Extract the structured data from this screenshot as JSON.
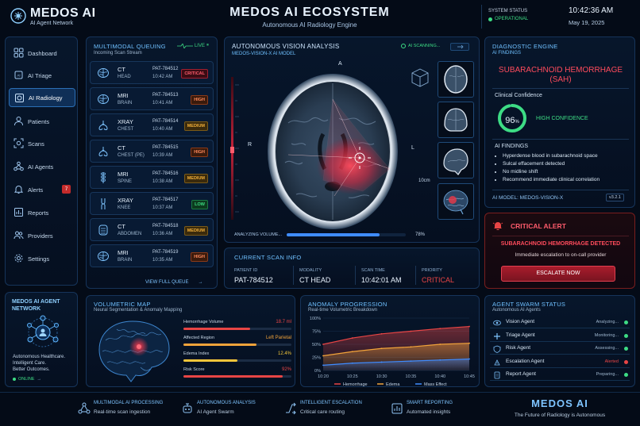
{
  "header": {
    "brand": "MEDOS AI",
    "brand_sub": "AI Agent Network",
    "title": "MEDOS AI ECOSYSTEM",
    "subtitle": "Autonomous AI Radiology Engine",
    "system_status_label": "SYSTEM STATUS",
    "system_status_value": "OPERATIONAL",
    "time": "10:42:36 AM",
    "date": "May 19, 2025"
  },
  "sidebar": {
    "items": [
      {
        "label": "Dashboard",
        "icon": "grid-icon"
      },
      {
        "label": "AI Triage",
        "icon": "ai-chip-icon"
      },
      {
        "label": "AI Radiology",
        "icon": "radiology-icon",
        "active": true
      },
      {
        "label": "Patients",
        "icon": "user-icon"
      },
      {
        "label": "Scans",
        "icon": "scan-icon"
      },
      {
        "label": "AI Agents",
        "icon": "agents-icon"
      },
      {
        "label": "Alerts",
        "icon": "bell-icon",
        "badge": "7"
      },
      {
        "label": "Reports",
        "icon": "chart-icon"
      },
      {
        "label": "Providers",
        "icon": "people-icon"
      },
      {
        "label": "Settings",
        "icon": "gear-icon"
      }
    ],
    "network_title": "MEDOS AI AGENT NETWORK",
    "network_tagline_1": "Autonomous Healthcare.",
    "network_tagline_2": "Intelligent Care.",
    "network_tagline_3": "Better Outcomes.",
    "online": "ONLINE"
  },
  "queue": {
    "title": "MULTIMODAL QUEUING",
    "subtitle": "Incoming Scan Stream",
    "live": "LIVE",
    "view_full": "VIEW FULL QUEUE",
    "items": [
      {
        "modality": "CT",
        "part": "HEAD",
        "id": "PAT-784512",
        "time": "10:42 AM",
        "priority": "CRITICAL",
        "icon": "brain-icon"
      },
      {
        "modality": "MRI",
        "part": "BRAIN",
        "id": "PAT-784513",
        "time": "10:41 AM",
        "priority": "HIGH",
        "icon": "brain-icon"
      },
      {
        "modality": "XRAY",
        "part": "CHEST",
        "id": "PAT-784514",
        "time": "10:40 AM",
        "priority": "MEDIUM",
        "icon": "lungs-icon"
      },
      {
        "modality": "CT",
        "part": "CHEST (PE)",
        "id": "PAT-784515",
        "time": "10:39 AM",
        "priority": "HIGH",
        "icon": "lungs-icon"
      },
      {
        "modality": "MRI",
        "part": "SPINE",
        "id": "PAT-784516",
        "time": "10:38 AM",
        "priority": "MEDIUM",
        "icon": "spine-icon"
      },
      {
        "modality": "XRAY",
        "part": "KNEE",
        "id": "PAT-784517",
        "time": "10:37 AM",
        "priority": "LOW",
        "icon": "knee-icon"
      },
      {
        "modality": "CT",
        "part": "ABDOMEN",
        "id": "PAT-784518",
        "time": "10:36 AM",
        "priority": "MEDIUM",
        "icon": "abdomen-icon"
      },
      {
        "modality": "MRI",
        "part": "BRAIN",
        "id": "PAT-784519",
        "time": "10:35 AM",
        "priority": "HIGH",
        "icon": "brain-icon"
      }
    ]
  },
  "vision": {
    "title": "AUTONOMOUS VISION ANALYSIS",
    "model": "MEDOS-VISION-X AI MODEL",
    "scanning": "AI SCANNING...",
    "orient_top": "A",
    "orient_left": "R",
    "orient_right": "L",
    "scale": "10cm",
    "analyzing_label": "ANALYZING VOLUME...",
    "analyzing_progress": 78,
    "analyzing_text": "78%"
  },
  "scan_info": {
    "title": "CURRENT SCAN INFO",
    "patient_id_label": "PATIENT ID",
    "patient_id": "PAT-784512",
    "modality_label": "MODALITY",
    "modality": "CT HEAD",
    "scan_time_label": "SCAN TIME",
    "scan_time": "10:42:01 AM",
    "priority_label": "PRIORITY",
    "priority": "CRITICAL"
  },
  "diagnostic": {
    "title": "DIAGNOSTIC ENGINE",
    "subtitle": "AI FINDINGS",
    "diagnosis_line1": "SUBARACHNOID HEMORRHAGE",
    "diagnosis_line2": "(SAH)",
    "confidence_label": "Clinical Confidence",
    "confidence_value": 96,
    "confidence_number": "96",
    "confidence_unit": "%",
    "confidence_text": "HIGH CONFIDENCE",
    "findings_title": "AI FINDINGS",
    "findings": [
      "Hyperdense blood in subarachnoid space",
      "Sulcal effacement detected",
      "No midline shift",
      "Recommend immediate clinical correlation"
    ],
    "model": "AI MODEL: MEDOS-VISION-X",
    "version": "v3.2.1"
  },
  "alert": {
    "title": "CRITICAL ALERT",
    "headline": "SUBARACHNOID HEMORRHAGE DETECTED",
    "detail": "Immediate escalation to on-call provider",
    "button": "ESCALATE NOW"
  },
  "volumetric": {
    "title": "VOLUMETRIC MAP",
    "subtitle": "Neural Segmentation & Anomaly Mapping",
    "metrics": [
      {
        "label": "Hemorrhage Volume",
        "value": "18.7 ml",
        "fill": 0.62,
        "color": "#e84545"
      },
      {
        "label": "Affected Region",
        "value": "Left Parietal",
        "fill": 0.68,
        "color": "#f2a33a"
      },
      {
        "label": "Edema Index",
        "value": "12.4%",
        "fill": 0.5,
        "color": "#f2c53a"
      },
      {
        "label": "Risk Score",
        "value": "92%",
        "fill": 0.92,
        "color": "#e84545"
      }
    ]
  },
  "anomaly": {
    "title": "ANOMALY PROGRESSION",
    "subtitle": "Real-time Volumetric Breakdown"
  },
  "chart_data": {
    "type": "area",
    "x": [
      "10:20",
      "10:25",
      "10:30",
      "10:35",
      "10:40",
      "10:45"
    ],
    "ylim": [
      0,
      100
    ],
    "yticks": [
      "0%",
      "25%",
      "50%",
      "75%",
      "100%"
    ],
    "series": [
      {
        "name": "Hemorrhage",
        "color": "#e84545",
        "values": [
          50,
          62,
          70,
          75,
          80,
          84
        ]
      },
      {
        "name": "Edema",
        "color": "#f2a33a",
        "values": [
          28,
          36,
          42,
          45,
          50,
          52
        ]
      },
      {
        "name": "Mass Effect",
        "color": "#3f8cff",
        "values": [
          10,
          14,
          16,
          18,
          20,
          22
        ]
      }
    ]
  },
  "swarm": {
    "title": "AGENT SWARM STATUS",
    "subtitle": "Autonomous AI Agents",
    "agents": [
      {
        "name": "Vision Agent",
        "status": "Analyzing...",
        "color": "#3ddc84",
        "icon": "eye-icon"
      },
      {
        "name": "Triage Agent",
        "status": "Monitoring...",
        "color": "#3ddc84",
        "icon": "triage-icon"
      },
      {
        "name": "Risk Agent",
        "status": "Assessing...",
        "color": "#3ddc84",
        "icon": "shield-icon"
      },
      {
        "name": "Escalation Agent",
        "status": "Alerted",
        "color": "#e84545",
        "icon": "escalate-icon"
      },
      {
        "name": "Report Agent",
        "status": "Preparing...",
        "color": "#3ddc84",
        "icon": "document-icon"
      }
    ]
  },
  "footer": {
    "features": [
      {
        "title": "MULTIMODAL AI PROCESSING",
        "sub": "Real-time scan ingestion"
      },
      {
        "title": "AUTONOMOUS ANALYSIS",
        "sub": "AI Agent Swarm"
      },
      {
        "title": "INTELLIGENT ESCALATION",
        "sub": "Critical care routing"
      },
      {
        "title": "SMART REPORTING",
        "sub": "Automated insights"
      }
    ],
    "brand": "MEDOS AI",
    "tagline": "The Future of Radiology is Autonomous"
  },
  "colors": {
    "accent": "#6fc0ff",
    "critical": "#e84545",
    "ok": "#3ddc84",
    "medium": "#f2a33a"
  }
}
